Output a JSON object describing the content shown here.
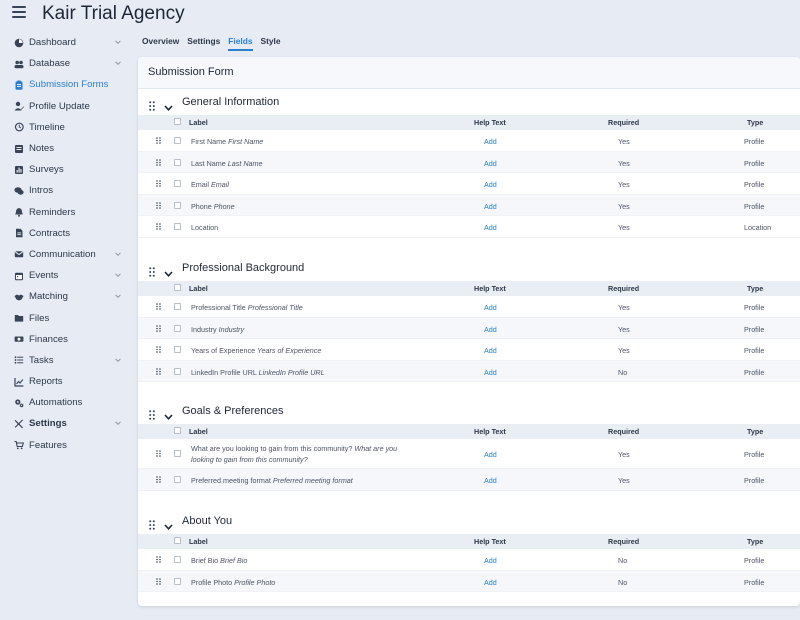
{
  "app": {
    "title": "Kair Trial Agency"
  },
  "sidebar": {
    "items": [
      {
        "label": "Dashboard",
        "icon": "dashboard-icon",
        "chevron": true
      },
      {
        "label": "Database",
        "icon": "users-icon",
        "chevron": true
      },
      {
        "label": "Submission Forms",
        "icon": "clipboard-icon",
        "active": true
      },
      {
        "label": "Profile Update",
        "icon": "user-edit-icon"
      },
      {
        "label": "Timeline",
        "icon": "history-icon"
      },
      {
        "label": "Notes",
        "icon": "note-icon"
      },
      {
        "label": "Surveys",
        "icon": "poll-icon"
      },
      {
        "label": "Intros",
        "icon": "chat-icon"
      },
      {
        "label": "Reminders",
        "icon": "bell-icon"
      },
      {
        "label": "Contracts",
        "icon": "document-icon"
      },
      {
        "label": "Communication",
        "icon": "mail-icon",
        "chevron": true
      },
      {
        "label": "Events",
        "icon": "calendar-icon",
        "chevron": true
      },
      {
        "label": "Matching",
        "icon": "handshake-icon",
        "chevron": true
      },
      {
        "label": "Files",
        "icon": "folder-icon"
      },
      {
        "label": "Finances",
        "icon": "money-icon"
      },
      {
        "label": "Tasks",
        "icon": "list-icon",
        "chevron": true
      },
      {
        "label": "Reports",
        "icon": "chart-icon"
      },
      {
        "label": "Automations",
        "icon": "cogs-icon"
      },
      {
        "label": "Settings",
        "icon": "tools-icon",
        "chevron": true,
        "bold": true
      },
      {
        "label": "Features",
        "icon": "cart-icon"
      }
    ]
  },
  "tabs": [
    {
      "label": "Overview"
    },
    {
      "label": "Settings"
    },
    {
      "label": "Fields",
      "active": true
    },
    {
      "label": "Style"
    }
  ],
  "card": {
    "title": "Submission Form"
  },
  "columns": {
    "label": "Label",
    "help": "Help Text",
    "required": "Required",
    "type": "Type"
  },
  "sections": [
    {
      "title": "General Information",
      "rows": [
        {
          "label": "First Name",
          "placeholder": "First Name",
          "help": "Add",
          "required": "Yes",
          "type": "Profile"
        },
        {
          "label": "Last Name",
          "placeholder": "Last Name",
          "help": "Add",
          "required": "Yes",
          "type": "Profile"
        },
        {
          "label": "Email",
          "placeholder": "Email",
          "help": "Add",
          "required": "Yes",
          "type": "Profile"
        },
        {
          "label": "Phone",
          "placeholder": "Phone",
          "help": "Add",
          "required": "Yes",
          "type": "Profile"
        },
        {
          "label": "Location",
          "placeholder": "",
          "help": "Add",
          "required": "Yes",
          "type": "Location"
        }
      ]
    },
    {
      "title": "Professional Background",
      "rows": [
        {
          "label": "Professional Title",
          "placeholder": "Professional Title",
          "help": "Add",
          "required": "Yes",
          "type": "Profile"
        },
        {
          "label": "Industry",
          "placeholder": "Industry",
          "help": "Add",
          "required": "Yes",
          "type": "Profile"
        },
        {
          "label": "Years of Experience",
          "placeholder": "Years of Experience",
          "help": "Add",
          "required": "Yes",
          "type": "Profile"
        },
        {
          "label": "LinkedIn Profile URL",
          "placeholder": "LinkedIn Profile URL",
          "help": "Add",
          "required": "No",
          "type": "Profile"
        }
      ]
    },
    {
      "title": "Goals & Preferences",
      "rows": [
        {
          "label": "What are you looking to gain from this community?",
          "placeholder": "What are you looking to gain from this community?",
          "help": "Add",
          "required": "Yes",
          "type": "Profile",
          "tall": true
        },
        {
          "label": "Preferred meeting format",
          "placeholder": "Preferred meeting format",
          "help": "Add",
          "required": "Yes",
          "type": "Profile"
        }
      ]
    },
    {
      "title": "About You",
      "rows": [
        {
          "label": "Brief Bio",
          "placeholder": "Brief Bio",
          "help": "Add",
          "required": "No",
          "type": "Profile"
        },
        {
          "label": "Profile Photo",
          "placeholder": "Profile Photo",
          "help": "Add",
          "required": "No",
          "type": "Profile"
        }
      ]
    }
  ],
  "colors": {
    "accent": "#2a7fd0",
    "background": "#e7ecf4",
    "header": "#e9eef5"
  }
}
